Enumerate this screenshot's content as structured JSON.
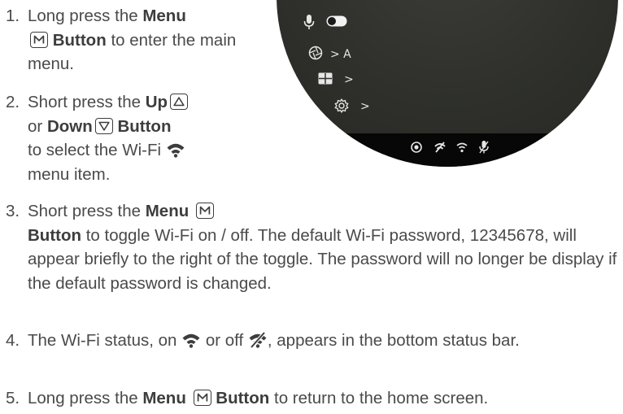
{
  "steps": [
    {
      "num": "1.",
      "pre": "Long press the",
      "b1": "Menu",
      "icon": "M",
      "b2": "Button",
      "post": "to enter the main menu."
    },
    {
      "num": "2.",
      "pre": "Short press the",
      "b_up": "Up",
      "mid": "or",
      "b_down": "Down",
      "b_button": "Button",
      "post": "to select the Wi-Fi",
      "post2": "menu item."
    },
    {
      "num": "3.",
      "pre": "Short press the",
      "b1": "Menu",
      "icon": "M",
      "b2": "Button",
      "post": "to toggle Wi-Fi on / off. The default Wi-Fi password, 12345678, will appear briefly to the right of the toggle. The password will no longer be display if the default password is changed."
    },
    {
      "num": "4.",
      "pre": "The Wi-Fi status, on",
      "mid": "or off",
      "post": ", appears in the bottom status bar."
    },
    {
      "num": "5.",
      "pre": "Long press the",
      "b1": "Menu",
      "icon": "M",
      "b2": "Button",
      "post": "to return to the home screen."
    }
  ],
  "device": {
    "aperture_value": "> A",
    "layout_value": ">",
    "settings_value": ">",
    "screen_color": "#2f302b",
    "statusbar_color": "#070707",
    "icon_color": "#e6e6e6",
    "icons": [
      "microphone-icon",
      "toggle-switch",
      "aperture-icon",
      "grid-layout-icon",
      "settings-gear-icon",
      "record-icon",
      "wifi-off-icon",
      "wifi-icon",
      "mic-off-icon"
    ]
  }
}
